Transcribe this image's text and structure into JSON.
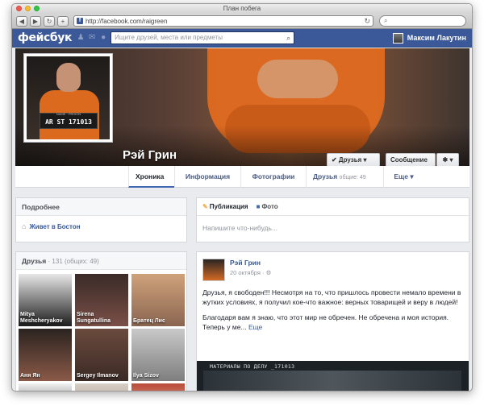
{
  "window": {
    "title": "План побега"
  },
  "browser": {
    "back": "◀",
    "forward": "▶",
    "url": "http://facebook.com/raigreen",
    "search_icon": "⌕"
  },
  "fbbar": {
    "logo": "фейсбук",
    "search_placeholder": "Ищите друзей, места или предметы",
    "user_name": "Максим Лакутин"
  },
  "profile": {
    "name": "Рэй Грин",
    "plate_text": "AR ST 171013",
    "plate_sub": "NAME · PRISON",
    "buttons": {
      "friends": "✔ Друзья ▾",
      "message": "Сообщение",
      "gear": "✱ ▾"
    }
  },
  "tabs": [
    {
      "label": "Хроника"
    },
    {
      "label": "Информация"
    },
    {
      "label": "Фотографии"
    },
    {
      "label": "Друзья",
      "count": "общие: 49"
    },
    {
      "label": "Еще ▾"
    }
  ],
  "about": {
    "title": "Подробнее",
    "lives_in": "Живет в Бостон"
  },
  "friends": {
    "title": "Друзья",
    "count_text": "· 131 (общих: 49)",
    "list": [
      {
        "name": "Mitya Meshcheryakov",
        "color_top": "#e7e7e7",
        "color_bottom": "#1c1c1c"
      },
      {
        "name": "Sirena Sungatullina",
        "color_top": "#3a2a26",
        "color_bottom": "#7a5048"
      },
      {
        "name": "Братец Лис",
        "color_top": "#cfa27b",
        "color_bottom": "#8a6550"
      },
      {
        "name": "Аня Ян",
        "color_top": "#2b2320",
        "color_bottom": "#8b5a48"
      },
      {
        "name": "Sergey Ilmanov",
        "color_top": "#6a4a3d",
        "color_bottom": "#3b2a25"
      },
      {
        "name": "Ilya Sizov",
        "color_top": "#c9c9c9",
        "color_bottom": "#7e7e7e"
      },
      {
        "name": "",
        "color_top": "#f1f1f1",
        "color_bottom": "#3a3a3a"
      },
      {
        "name": "",
        "color_top": "#d6d0c8",
        "color_bottom": "#a68b6e"
      },
      {
        "name": "",
        "color_top": "#b94c3a",
        "color_bottom": "#e8c2a9"
      }
    ]
  },
  "composer": {
    "tab_post": "Публикация",
    "tab_photo": "Фото",
    "placeholder": "Напишите что-нибудь..."
  },
  "post": {
    "author": "Рэй Грин",
    "date": "20 октября · ⚙",
    "p1": "Друзья, я свободен!!! Несмотря на то, что пришлось провести немало времени в жутких условиях, я получил кое-что важное: верных товарищей и веру в людей!",
    "p2": "Благодаря вам я знаю, что этот мир не обречен. Не обречена и моя история. Теперь у ме...",
    "more": "Еще",
    "image_caption": "МАТЕРИАЛЫ ПО ДЕЛУ _171013"
  }
}
